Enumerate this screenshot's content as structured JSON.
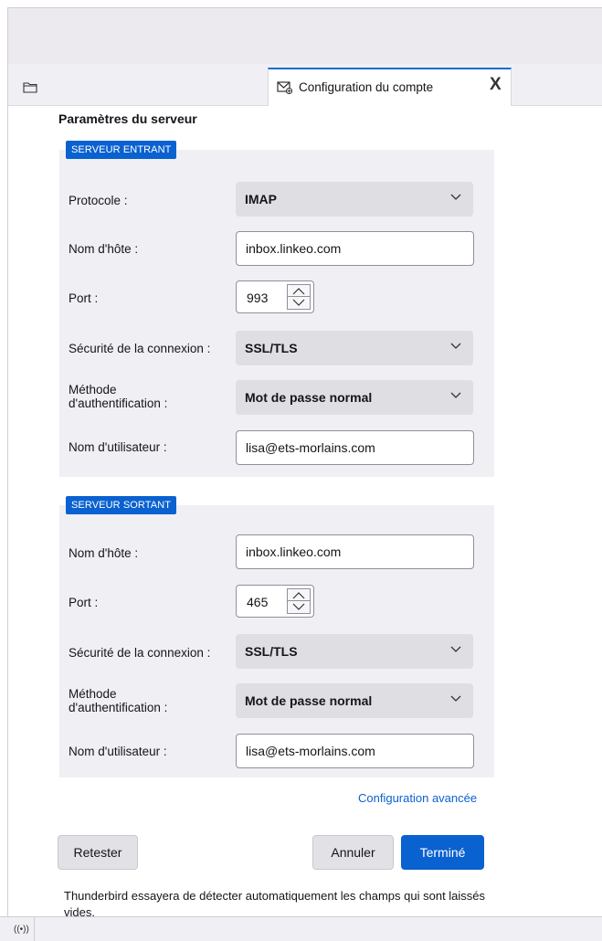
{
  "tab": {
    "label": "Configuration du compte",
    "close_glyph": "X"
  },
  "page": {
    "section_title": "Paramètres du serveur"
  },
  "incoming": {
    "legend": "SERVEUR ENTRANT",
    "protocol_label": "Protocole :",
    "protocol_value": "IMAP",
    "hostname_label": "Nom d'hôte :",
    "hostname_value": "inbox.linkeo.com",
    "port_label": "Port :",
    "port_value": "993",
    "security_label": "Sécurité de la connexion :",
    "security_value": "SSL/TLS",
    "auth_label_line1": "Méthode",
    "auth_label_line2": "d'authentification :",
    "auth_value": "Mot de passe normal",
    "username_label": "Nom d'utilisateur :",
    "username_value": "lisa@ets-morlains.com"
  },
  "outgoing": {
    "legend": "SERVEUR SORTANT",
    "hostname_label": "Nom d'hôte :",
    "hostname_value": "inbox.linkeo.com",
    "port_label": "Port :",
    "port_value": "465",
    "security_label": "Sécurité de la connexion :",
    "security_value": "SSL/TLS",
    "auth_label_line1": "Méthode",
    "auth_label_line2": "d'authentification :",
    "auth_value": "Mot de passe normal",
    "username_label": "Nom d'utilisateur :",
    "username_value": "lisa@ets-morlains.com"
  },
  "links": {
    "advanced": "Configuration avancée"
  },
  "buttons": {
    "retest": "Retester",
    "cancel": "Annuler",
    "done": "Terminé"
  },
  "footnote": {
    "line1": "Thunderbird essayera de détecter automatiquement les champs qui sont laissés",
    "line2": "vides."
  },
  "statusbar": {
    "icon_glyph": "((•))"
  },
  "colors": {
    "accent": "#0a61d0",
    "panel_bg": "#f0f0f4",
    "select_bg": "#dfdfe3"
  },
  "icons": {
    "folder": "folder-icon",
    "tab": "mail-settings-icon",
    "close": "close-icon",
    "select": "chevron-down-icon",
    "spin_up": "chevron-up-icon",
    "spin_down": "chevron-down-icon",
    "status": "activity-icon"
  }
}
